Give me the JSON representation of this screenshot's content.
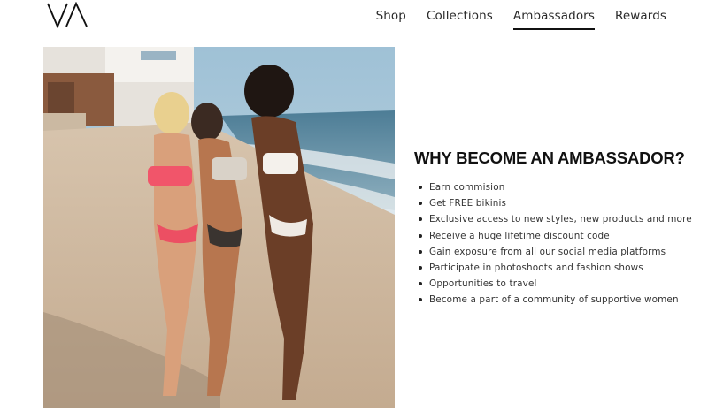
{
  "brand": {
    "logo_text": "VA"
  },
  "nav": {
    "items": [
      {
        "label": "Shop",
        "active": false
      },
      {
        "label": "Collections",
        "active": false
      },
      {
        "label": "Ambassadors",
        "active": true
      },
      {
        "label": "Rewards",
        "active": false
      }
    ]
  },
  "hero": {
    "image_subject": "beach-photo"
  },
  "section": {
    "headline": "WHY BECOME AN AMBASSADOR?",
    "benefits": [
      "Earn commision",
      "Get FREE bikinis",
      "Exclusive access to new styles, new products and more",
      "Receive a huge lifetime discount code",
      "Gain exposure from all our social media platforms",
      "Participate in photoshoots and fashion shows",
      "Opportunities to travel",
      "Become a part of a community of supportive women"
    ]
  }
}
